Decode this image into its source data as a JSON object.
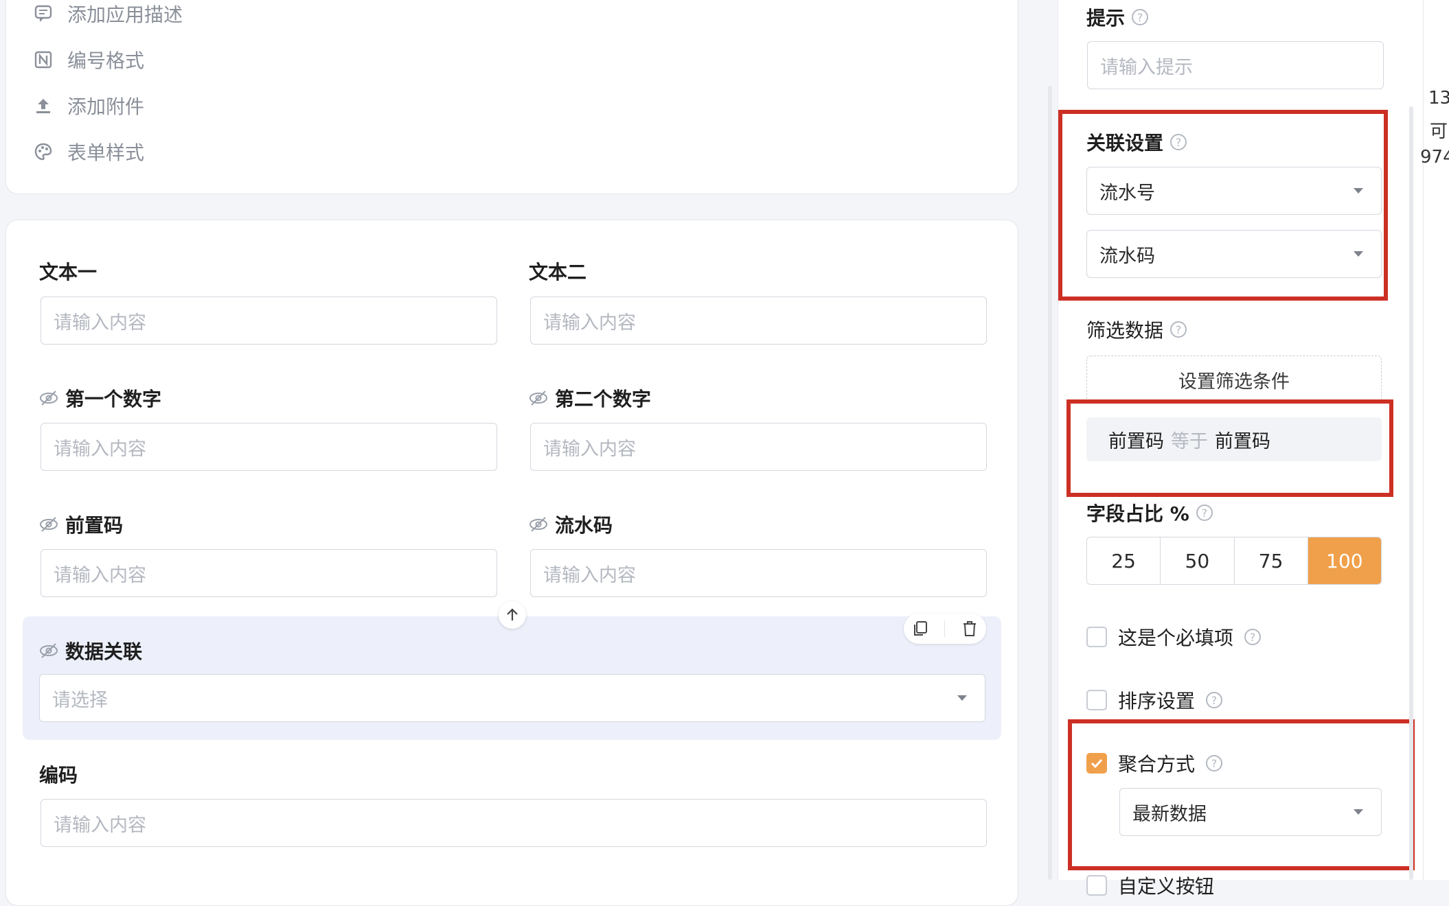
{
  "top_menu": [
    {
      "label": "添加应用描述",
      "icon": "comment-icon"
    },
    {
      "label": "编号格式",
      "icon": "number-format-icon"
    },
    {
      "label": "添加附件",
      "icon": "upload-icon"
    },
    {
      "label": "表单样式",
      "icon": "palette-icon"
    }
  ],
  "form": {
    "text1": {
      "label": "文本一",
      "placeholder": "请输入内容"
    },
    "text2": {
      "label": "文本二",
      "placeholder": "请输入内容"
    },
    "num1": {
      "label": "第一个数字",
      "placeholder": "请输入内容"
    },
    "num2": {
      "label": "第二个数字",
      "placeholder": "请输入内容"
    },
    "prefix": {
      "label": "前置码",
      "placeholder": "请输入内容"
    },
    "serial": {
      "label": "流水码",
      "placeholder": "请输入内容"
    },
    "relation": {
      "label": "数据关联",
      "placeholder": "请选择"
    },
    "code": {
      "label": "编码",
      "placeholder": "请输入内容"
    }
  },
  "panel": {
    "hint": {
      "label": "提示",
      "placeholder": "请输入提示"
    },
    "link_settings": {
      "label": "关联设置",
      "select1": "流水号",
      "select2": "流水码"
    },
    "filter": {
      "label": "筛选数据",
      "button": "设置筛选条件",
      "chip_field": "前置码",
      "chip_op": "等于",
      "chip_value": "前置码"
    },
    "width": {
      "label": "字段占比 %",
      "options": [
        "25",
        "50",
        "75",
        "100"
      ],
      "selected": "100"
    },
    "required": {
      "label": "这是个必填项",
      "checked": false
    },
    "sort": {
      "label": "排序设置",
      "checked": false
    },
    "aggregate": {
      "label": "聚合方式",
      "checked": true,
      "value": "最新数据"
    },
    "custom_btn": {
      "label": "自定义按钮"
    }
  },
  "far_right": {
    "line1": "13",
    "line2": "可",
    "line3": "974"
  },
  "colors": {
    "accent": "#f0a04b",
    "annotation": "#cc2f24"
  }
}
